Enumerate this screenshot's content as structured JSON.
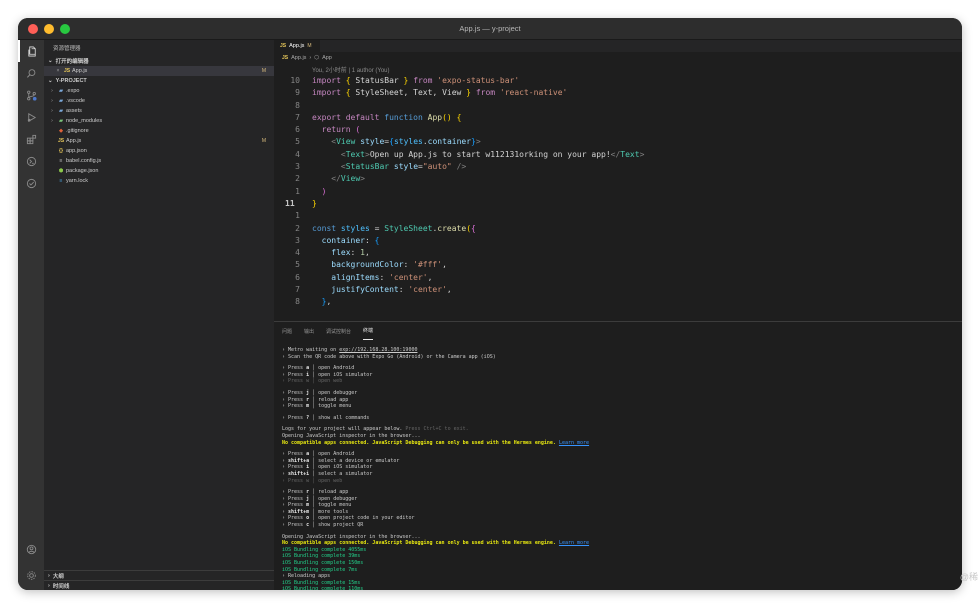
{
  "window": {
    "title": "App.js — y-project"
  },
  "activity_bar": {
    "icons": [
      "files-icon",
      "search-icon",
      "source-control-icon",
      "run-debug-icon",
      "extensions-icon",
      "remote-icon",
      "testing-icon",
      "account-icon",
      "settings-gear-icon"
    ]
  },
  "sidebar": {
    "header": "资源管理器",
    "open_editors": {
      "title": "打开的编辑器",
      "items": [
        {
          "name": "App.js",
          "badge": "M"
        }
      ]
    },
    "project": {
      "title": "Y-PROJECT",
      "items": [
        {
          "name": ".expo",
          "type": "folder",
          "color": "#7aa7d8"
        },
        {
          "name": ".vscode",
          "type": "folder",
          "color": "#7aa7d8"
        },
        {
          "name": "assets",
          "type": "folder",
          "color": "#7aa7d8"
        },
        {
          "name": "node_modules",
          "type": "folder",
          "color": "#7ac47a"
        },
        {
          "name": ".gitignore",
          "type": "file",
          "icon": "◆",
          "color": "#e0623a"
        },
        {
          "name": "App.js",
          "type": "file",
          "icon": "JS",
          "color": "#e8c85a",
          "badge": "M"
        },
        {
          "name": "app.json",
          "type": "file",
          "icon": "{}",
          "color": "#e8c85a"
        },
        {
          "name": "babel.config.js",
          "type": "file",
          "icon": "≡",
          "color": "#c8c8c8"
        },
        {
          "name": "package.json",
          "type": "file",
          "icon": "⬢",
          "color": "#8cc84b"
        },
        {
          "name": "yarn.lock",
          "type": "file",
          "icon": "≡",
          "color": "#4aa3df"
        }
      ]
    },
    "outline": "大纲",
    "timeline": "时间线"
  },
  "editor": {
    "tab": {
      "label": "App.js",
      "badge": "M"
    },
    "breadcrumb": {
      "file": "App.js",
      "symbol": "App"
    },
    "blame": "You, 2小时前 | 1 author (You)",
    "lines": [
      {
        "n": "10",
        "tokens": [
          [
            "kw",
            "import"
          ],
          [
            "plain",
            " "
          ],
          [
            "br1",
            "{"
          ],
          [
            "plain",
            " StatusBar "
          ],
          [
            "br1",
            "}"
          ],
          [
            "plain",
            " "
          ],
          [
            "kw",
            "from"
          ],
          [
            "plain",
            " "
          ],
          [
            "str",
            "'expo-status-bar'"
          ]
        ]
      },
      {
        "n": "9",
        "tokens": [
          [
            "kw",
            "import"
          ],
          [
            "plain",
            " "
          ],
          [
            "br1",
            "{"
          ],
          [
            "plain",
            " StyleSheet, Text, View "
          ],
          [
            "br1",
            "}"
          ],
          [
            "plain",
            " "
          ],
          [
            "kw",
            "from"
          ],
          [
            "plain",
            " "
          ],
          [
            "str",
            "'react-native'"
          ]
        ]
      },
      {
        "n": "8",
        "tokens": []
      },
      {
        "n": "7",
        "tokens": [
          [
            "kw",
            "export"
          ],
          [
            "plain",
            " "
          ],
          [
            "kw",
            "default"
          ],
          [
            "plain",
            " "
          ],
          [
            "kw2",
            "function"
          ],
          [
            "plain",
            " "
          ],
          [
            "fn",
            "App"
          ],
          [
            "br1",
            "()"
          ],
          [
            "plain",
            " "
          ],
          [
            "br1",
            "{"
          ]
        ]
      },
      {
        "n": "6",
        "tokens": [
          [
            "plain",
            "  "
          ],
          [
            "kw",
            "return"
          ],
          [
            "plain",
            " "
          ],
          [
            "br2",
            "("
          ]
        ]
      },
      {
        "n": "5",
        "tokens": [
          [
            "plain",
            "    "
          ],
          [
            "gray",
            "<"
          ],
          [
            "tag",
            "View"
          ],
          [
            "plain",
            " "
          ],
          [
            "attr",
            "style"
          ],
          [
            "plain",
            "="
          ],
          [
            "br3",
            "{"
          ],
          [
            "var",
            "styles"
          ],
          [
            "plain",
            "."
          ],
          [
            "prop",
            "container"
          ],
          [
            "br3",
            "}"
          ],
          [
            "gray",
            ">"
          ]
        ]
      },
      {
        "n": "4",
        "tokens": [
          [
            "plain",
            "      "
          ],
          [
            "gray",
            "<"
          ],
          [
            "tag",
            "Text"
          ],
          [
            "gray",
            ">"
          ],
          [
            "plain",
            "Open up App.js to start w112131orking on your app!"
          ],
          [
            "gray",
            "</"
          ],
          [
            "tag",
            "Text"
          ],
          [
            "gray",
            ">"
          ]
        ]
      },
      {
        "n": "3",
        "tokens": [
          [
            "plain",
            "      "
          ],
          [
            "gray",
            "<"
          ],
          [
            "tag",
            "StatusBar"
          ],
          [
            "plain",
            " "
          ],
          [
            "attr",
            "style"
          ],
          [
            "plain",
            "="
          ],
          [
            "str",
            "\"auto\""
          ],
          [
            "plain",
            " "
          ],
          [
            "gray",
            "/>"
          ]
        ]
      },
      {
        "n": "2",
        "tokens": [
          [
            "plain",
            "    "
          ],
          [
            "gray",
            "</"
          ],
          [
            "tag",
            "View"
          ],
          [
            "gray",
            ">"
          ]
        ]
      },
      {
        "n": "1",
        "tokens": [
          [
            "plain",
            "  "
          ],
          [
            "br2",
            ")"
          ]
        ]
      },
      {
        "n": "11",
        "current": true,
        "tokens": [
          [
            "br1",
            "}"
          ]
        ]
      },
      {
        "n": "1",
        "tokens": []
      },
      {
        "n": "2",
        "tokens": [
          [
            "kw2",
            "const"
          ],
          [
            "plain",
            " "
          ],
          [
            "var",
            "styles"
          ],
          [
            "plain",
            " = "
          ],
          [
            "tag",
            "StyleSheet"
          ],
          [
            "plain",
            "."
          ],
          [
            "fn",
            "create"
          ],
          [
            "br1",
            "("
          ],
          [
            "br2",
            "{"
          ]
        ]
      },
      {
        "n": "3",
        "tokens": [
          [
            "plain",
            "  "
          ],
          [
            "prop",
            "container"
          ],
          [
            "plain",
            ": "
          ],
          [
            "br3",
            "{"
          ]
        ]
      },
      {
        "n": "4",
        "tokens": [
          [
            "plain",
            "    "
          ],
          [
            "prop",
            "flex"
          ],
          [
            "plain",
            ": "
          ],
          [
            "num",
            "1"
          ],
          [
            "plain",
            ","
          ]
        ]
      },
      {
        "n": "5",
        "tokens": [
          [
            "plain",
            "    "
          ],
          [
            "prop",
            "backgroundColor"
          ],
          [
            "plain",
            ": "
          ],
          [
            "str",
            "'#fff'"
          ],
          [
            "plain",
            ","
          ]
        ]
      },
      {
        "n": "6",
        "tokens": [
          [
            "plain",
            "    "
          ],
          [
            "prop",
            "alignItems"
          ],
          [
            "plain",
            ": "
          ],
          [
            "str",
            "'center'"
          ],
          [
            "plain",
            ","
          ]
        ]
      },
      {
        "n": "7",
        "tokens": [
          [
            "plain",
            "    "
          ],
          [
            "prop",
            "justifyContent"
          ],
          [
            "plain",
            ": "
          ],
          [
            "str",
            "'center'"
          ],
          [
            "plain",
            ","
          ]
        ]
      },
      {
        "n": "8",
        "tokens": [
          [
            "plain",
            "  "
          ],
          [
            "br3",
            "}"
          ],
          [
            "plain",
            ","
          ]
        ]
      }
    ]
  },
  "panel": {
    "tabs": [
      "问题",
      "输出",
      "调试控制台",
      "终端"
    ],
    "active_tab": 3,
    "terminal_lines": [
      [
        [
          "plain",
          "› Metro waiting on "
        ],
        [
          "und",
          "exp://192.168.28.100:19000"
        ]
      ],
      [
        [
          "plain",
          "› Scan the QR code above with Expo Go (Android) or the Camera app (iOS)"
        ]
      ],
      "gap",
      [
        [
          "plain",
          "› Press "
        ],
        [
          "b",
          "a"
        ],
        [
          "plain",
          " │ open Android"
        ]
      ],
      [
        [
          "plain",
          "› Press "
        ],
        [
          "b",
          "i"
        ],
        [
          "plain",
          " │ open iOS simulator"
        ]
      ],
      [
        [
          "dim",
          "› Press w │ open web"
        ]
      ],
      "gap",
      [
        [
          "plain",
          "› Press "
        ],
        [
          "b",
          "j"
        ],
        [
          "plain",
          " │ open debugger"
        ]
      ],
      [
        [
          "plain",
          "› Press "
        ],
        [
          "b",
          "r"
        ],
        [
          "plain",
          " │ reload app"
        ]
      ],
      [
        [
          "plain",
          "› Press "
        ],
        [
          "b",
          "m"
        ],
        [
          "plain",
          " │ toggle menu"
        ]
      ],
      "gap",
      [
        [
          "plain",
          "› Press "
        ],
        [
          "b",
          "?"
        ],
        [
          "plain",
          " │ show all commands"
        ]
      ],
      "gap",
      [
        [
          "plain",
          "Logs for your project will appear below. "
        ],
        [
          "dim",
          "Press Ctrl+C to exit."
        ]
      ],
      [
        [
          "plain",
          "Opening JavaScript inspector in the browser..."
        ]
      ],
      [
        [
          "yel",
          "No compatible apps connected. JavaScript Debugging can only be used with the Hermes engine. "
        ],
        [
          "link",
          "Learn more"
        ]
      ],
      "gap",
      [
        [
          "plain",
          "› Press "
        ],
        [
          "b",
          "a"
        ],
        [
          "plain",
          " │ open Android"
        ]
      ],
      [
        [
          "plain",
          "› "
        ],
        [
          "b",
          "shift+a"
        ],
        [
          "plain",
          " │ select a device or emulator"
        ]
      ],
      [
        [
          "plain",
          "› Press "
        ],
        [
          "b",
          "i"
        ],
        [
          "plain",
          " │ open iOS simulator"
        ]
      ],
      [
        [
          "plain",
          "› "
        ],
        [
          "b",
          "shift+i"
        ],
        [
          "plain",
          " │ select a simulator"
        ]
      ],
      [
        [
          "dim",
          "› Press w │ open web"
        ]
      ],
      "gap",
      [
        [
          "plain",
          "› Press "
        ],
        [
          "b",
          "r"
        ],
        [
          "plain",
          " │ reload app"
        ]
      ],
      [
        [
          "plain",
          "› Press "
        ],
        [
          "b",
          "j"
        ],
        [
          "plain",
          " │ open debugger"
        ]
      ],
      [
        [
          "plain",
          "› Press "
        ],
        [
          "b",
          "m"
        ],
        [
          "plain",
          " │ toggle menu"
        ]
      ],
      [
        [
          "plain",
          "› "
        ],
        [
          "b",
          "shift+m"
        ],
        [
          "plain",
          " │ more tools"
        ]
      ],
      [
        [
          "plain",
          "› Press "
        ],
        [
          "b",
          "o"
        ],
        [
          "plain",
          " │ open project code in your editor"
        ]
      ],
      [
        [
          "plain",
          "› Press "
        ],
        [
          "b",
          "c"
        ],
        [
          "plain",
          " │ show project QR"
        ]
      ],
      "gap",
      [
        [
          "plain",
          "Opening JavaScript inspector in the browser..."
        ]
      ],
      [
        [
          "yel",
          "No compatible apps connected. JavaScript Debugging can only be used with the Hermes engine. "
        ],
        [
          "link",
          "Learn more"
        ]
      ],
      [
        [
          "grn",
          "iOS Bundling complete 4055ms"
        ]
      ],
      [
        [
          "grn",
          "iOS Bundling complete 39ms"
        ]
      ],
      [
        [
          "grn",
          "iOS Bundling complete 150ms"
        ]
      ],
      [
        [
          "grn",
          "iOS Bundling complete 7ms"
        ]
      ],
      [
        [
          "plain",
          "› Reloading apps"
        ]
      ],
      [
        [
          "grn",
          "iOS Bundling complete 15ms"
        ]
      ],
      [
        [
          "grn",
          "iOS Bundling complete 110ms"
        ]
      ],
      [
        [
          "plain",
          "› Reloading apps"
        ]
      ]
    ]
  },
  "watermark": "@稀"
}
